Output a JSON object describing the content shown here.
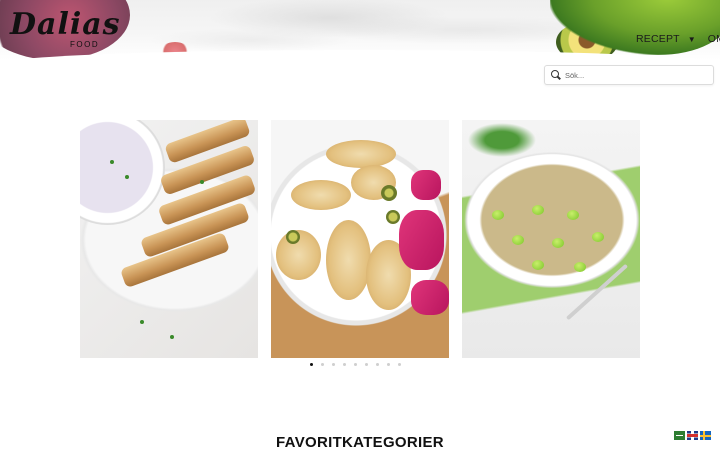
{
  "header": {
    "logo_script": "Dalias",
    "logo_sub": "FOOD",
    "nav": [
      {
        "label": "RECEPT",
        "has_dropdown": true
      },
      {
        "label": "OM",
        "has_dropdown": false
      }
    ]
  },
  "search": {
    "placeholder": "Sök...",
    "value": ""
  },
  "carousel": {
    "slides": [
      {
        "image": "yoghurt-dip-and-baked-rolls"
      },
      {
        "image": "chicken-fillets-with-pickles"
      },
      {
        "image": "rice-with-broad-beans"
      }
    ],
    "dot_count": 9,
    "active_index": 0
  },
  "sections": {
    "favorites_title": "FAVORITKATEGORIER"
  },
  "languages": [
    {
      "code": "ar",
      "icon": "saudi-flag-icon"
    },
    {
      "code": "en",
      "icon": "uk-flag-icon"
    },
    {
      "code": "sv",
      "icon": "sweden-flag-icon"
    }
  ],
  "colors": {
    "text": "#111111",
    "dot_active": "#111111",
    "dot_inactive": "#cfcfcf"
  }
}
